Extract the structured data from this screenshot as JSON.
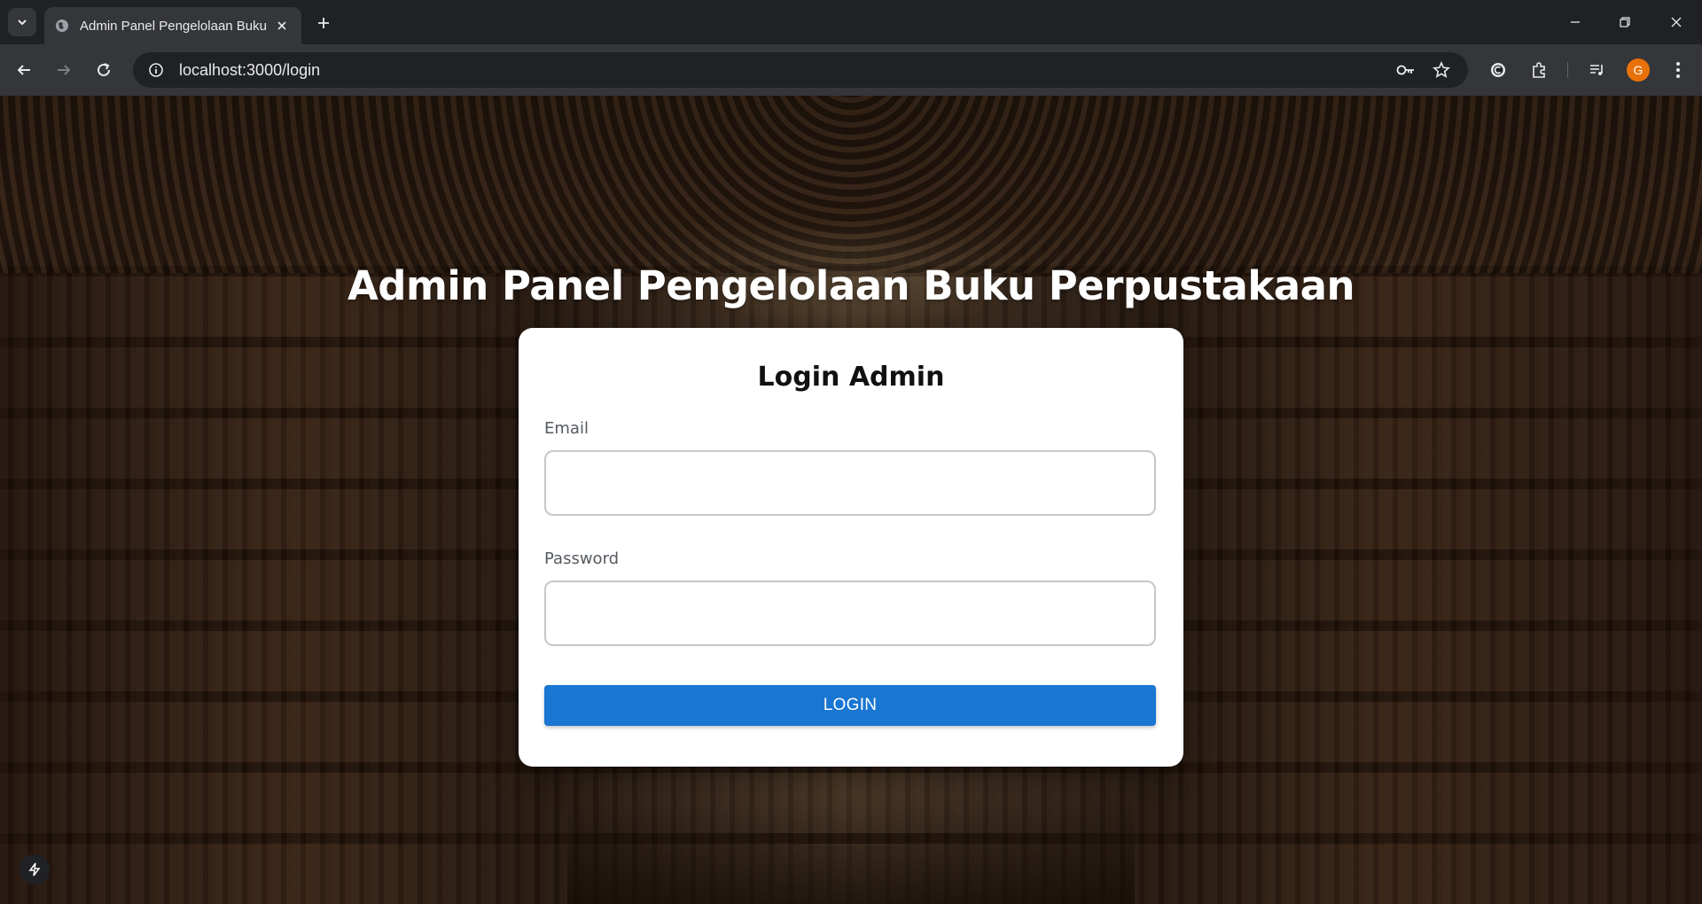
{
  "browser": {
    "tab": {
      "title": "Admin Panel Pengelolaan Buku Perpustakaan",
      "favicon": "globe-icon"
    },
    "address_bar": {
      "url": "localhost:3000/login"
    },
    "profile_initial": "G",
    "icons": [
      "tab-search-icon",
      "close-icon",
      "plus-icon",
      "minimize-icon",
      "restore-icon",
      "window-close-icon",
      "back-arrow-icon",
      "forward-arrow-icon",
      "reload-icon",
      "info-icon",
      "key-icon",
      "star-icon",
      "extension-c-icon",
      "puzzle-icon",
      "media-control-icon",
      "more-vert-icon"
    ]
  },
  "page": {
    "heading": "Admin Panel Pengelolaan Buku Perpustakaan",
    "login_form": {
      "title": "Login Admin",
      "email_label": "Email",
      "email_value": "",
      "password_label": "Password",
      "password_value": "",
      "submit_label": "LOGIN"
    },
    "floating_icon": "bolt-icon"
  },
  "colors": {
    "primary_button": "#1976d2",
    "card_background": "#ffffff",
    "heading_text": "#ffffff",
    "avatar": "#e8710a",
    "browser_dark": "#202124"
  }
}
